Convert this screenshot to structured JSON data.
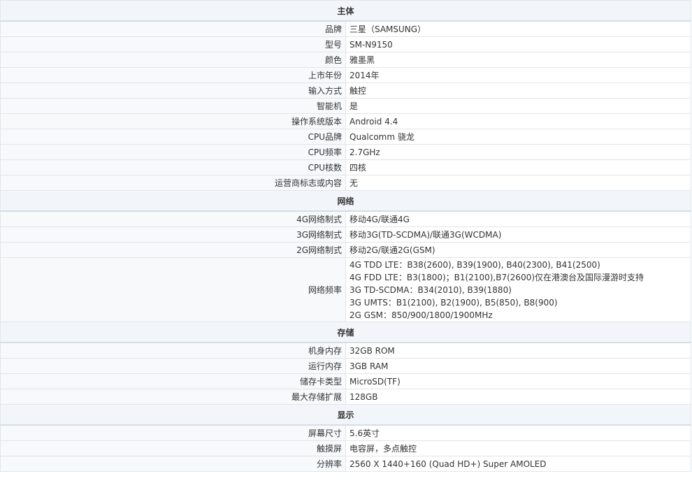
{
  "sections": [
    {
      "title": "主体",
      "rows": [
        {
          "label": "品牌",
          "value": "三星（SAMSUNG）"
        },
        {
          "label": "型号",
          "value": "SM-N9150"
        },
        {
          "label": "颜色",
          "value": "雅墨黑"
        },
        {
          "label": "上市年份",
          "value": "2014年"
        },
        {
          "label": "输入方式",
          "value": "触控"
        },
        {
          "label": "智能机",
          "value": "是"
        },
        {
          "label": "操作系统版本",
          "value": "Android 4.4"
        },
        {
          "label": "CPU品牌",
          "value": "Qualcomm 骁龙"
        },
        {
          "label": "CPU频率",
          "value": "2.7GHz"
        },
        {
          "label": "CPU核数",
          "value": "四核"
        },
        {
          "label": "运营商标志或内容",
          "value": "无"
        }
      ]
    },
    {
      "title": "网络",
      "rows": [
        {
          "label": "4G网络制式",
          "value": "移动4G/联通4G"
        },
        {
          "label": "3G网络制式",
          "value": "移动3G(TD-SCDMA)/联通3G(WCDMA)"
        },
        {
          "label": "2G网络制式",
          "value": "移动2G/联通2G(GSM)"
        },
        {
          "label": "网络频率",
          "lines": [
            "4G TDD LTE：B38(2600), B39(1900), B40(2300), B41(2500)",
            "4G FDD LTE：B3(1800)；B1(2100),B7(2600)仅在港澳台及国际漫游时支持",
            "3G TD-SCDMA：B34(2010), B39(1880)",
            "3G UMTS：B1(2100), B2(1900), B5(850), B8(900)",
            "2G GSM：850/900/1800/1900MHz"
          ]
        }
      ]
    },
    {
      "title": "存储",
      "rows": [
        {
          "label": "机身内存",
          "value": "32GB ROM"
        },
        {
          "label": "运行内存",
          "value": "3GB RAM"
        },
        {
          "label": "储存卡类型",
          "value": "MicroSD(TF)"
        },
        {
          "label": "最大存储扩展",
          "value": "128GB"
        }
      ]
    },
    {
      "title": "显示",
      "rows": [
        {
          "label": "屏幕尺寸",
          "value": "5.6英寸"
        },
        {
          "label": "触摸屏",
          "value": "电容屏，多点触控"
        },
        {
          "label": "分辨率",
          "value": "2560 X 1440+160 (Quad HD+) Super AMOLED"
        }
      ]
    }
  ]
}
